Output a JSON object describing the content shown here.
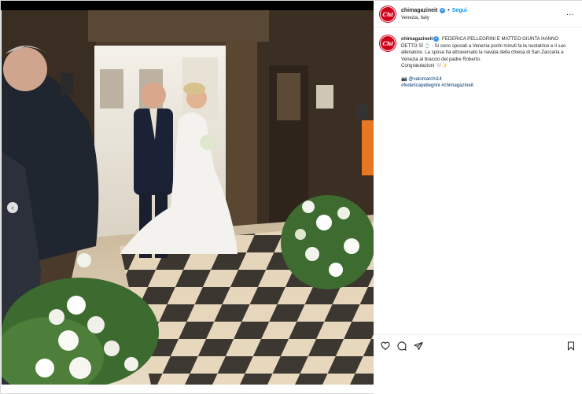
{
  "post": {
    "username": "chimagazineit",
    "logo_text": "Chi",
    "follow_label": "Segui",
    "location": "Venezia, Italy",
    "separator": "•",
    "more_label": "...",
    "caption_user": "chimagazineit",
    "caption_text": "FEDERICA PELLEGRINI E MATTEO GIUNTA HANNO DETTO SÌ 💍 - Si sono sposati a Venezia pochi minuti fa la nuotatrice e il suo allenatore. La sposa ha attraversato la navata della chiesa di San Zaccaria a Venezia al braccio del padre Roberto.",
    "congrats": "Congratulazioni",
    "congrats_emoji": "🤍✨",
    "mention_prefix": "📷",
    "mention": "@valomarchi14",
    "hashtags": "#federicapellegrini #chimagazineit"
  },
  "media": {
    "nav_prev": "‹",
    "slides": 4,
    "active_slide": 1
  },
  "icons": {
    "like": "heart-icon",
    "comment": "comment-icon",
    "share": "share-icon",
    "save": "bookmark-icon"
  },
  "colors": {
    "brand": "#d0021b",
    "link": "#0095f6",
    "mention": "#00376b",
    "verified": "#3897f0"
  }
}
